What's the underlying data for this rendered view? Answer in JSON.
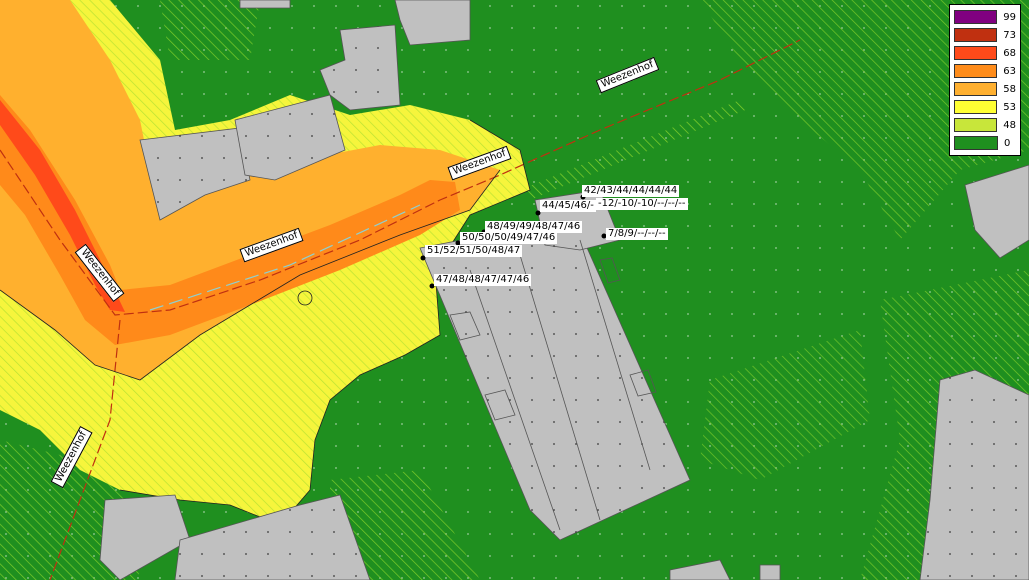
{
  "legend": {
    "items": [
      {
        "label": "99",
        "color": "#800080"
      },
      {
        "label": "73",
        "color": "#c03010"
      },
      {
        "label": "68",
        "color": "#ff4a1a"
      },
      {
        "label": "63",
        "color": "#ff8c1a"
      },
      {
        "label": "58",
        "color": "#ffb030"
      },
      {
        "label": "53",
        "color": "#ffff33"
      },
      {
        "label": "48",
        "color": "#c8e63a"
      },
      {
        "label": "0",
        "color": "#1f8f1f"
      }
    ]
  },
  "road_labels": {
    "r1": "Weezenhof",
    "r2": "Weezenhof",
    "r3": "Weezenhof",
    "r4": "Weezenhof",
    "r5": "Weezenhof"
  },
  "receptor_labels": {
    "p1": "42/43/44/44/44/44",
    "p2": "44/45/46/-",
    "p3": "-12/-10/-10/--/--/--",
    "p4": "7/8/9/--/--/--",
    "p5": "48/49/49/48/47/46",
    "p6": "50/50/50/49/47/46",
    "p7": "51/52/51/50/48/47",
    "p8": "47/48/48/47/47/46"
  },
  "colors": {
    "background_green": "#1f8f1f",
    "building_gray": "#c0c0c0",
    "road_red": "#c03010"
  }
}
